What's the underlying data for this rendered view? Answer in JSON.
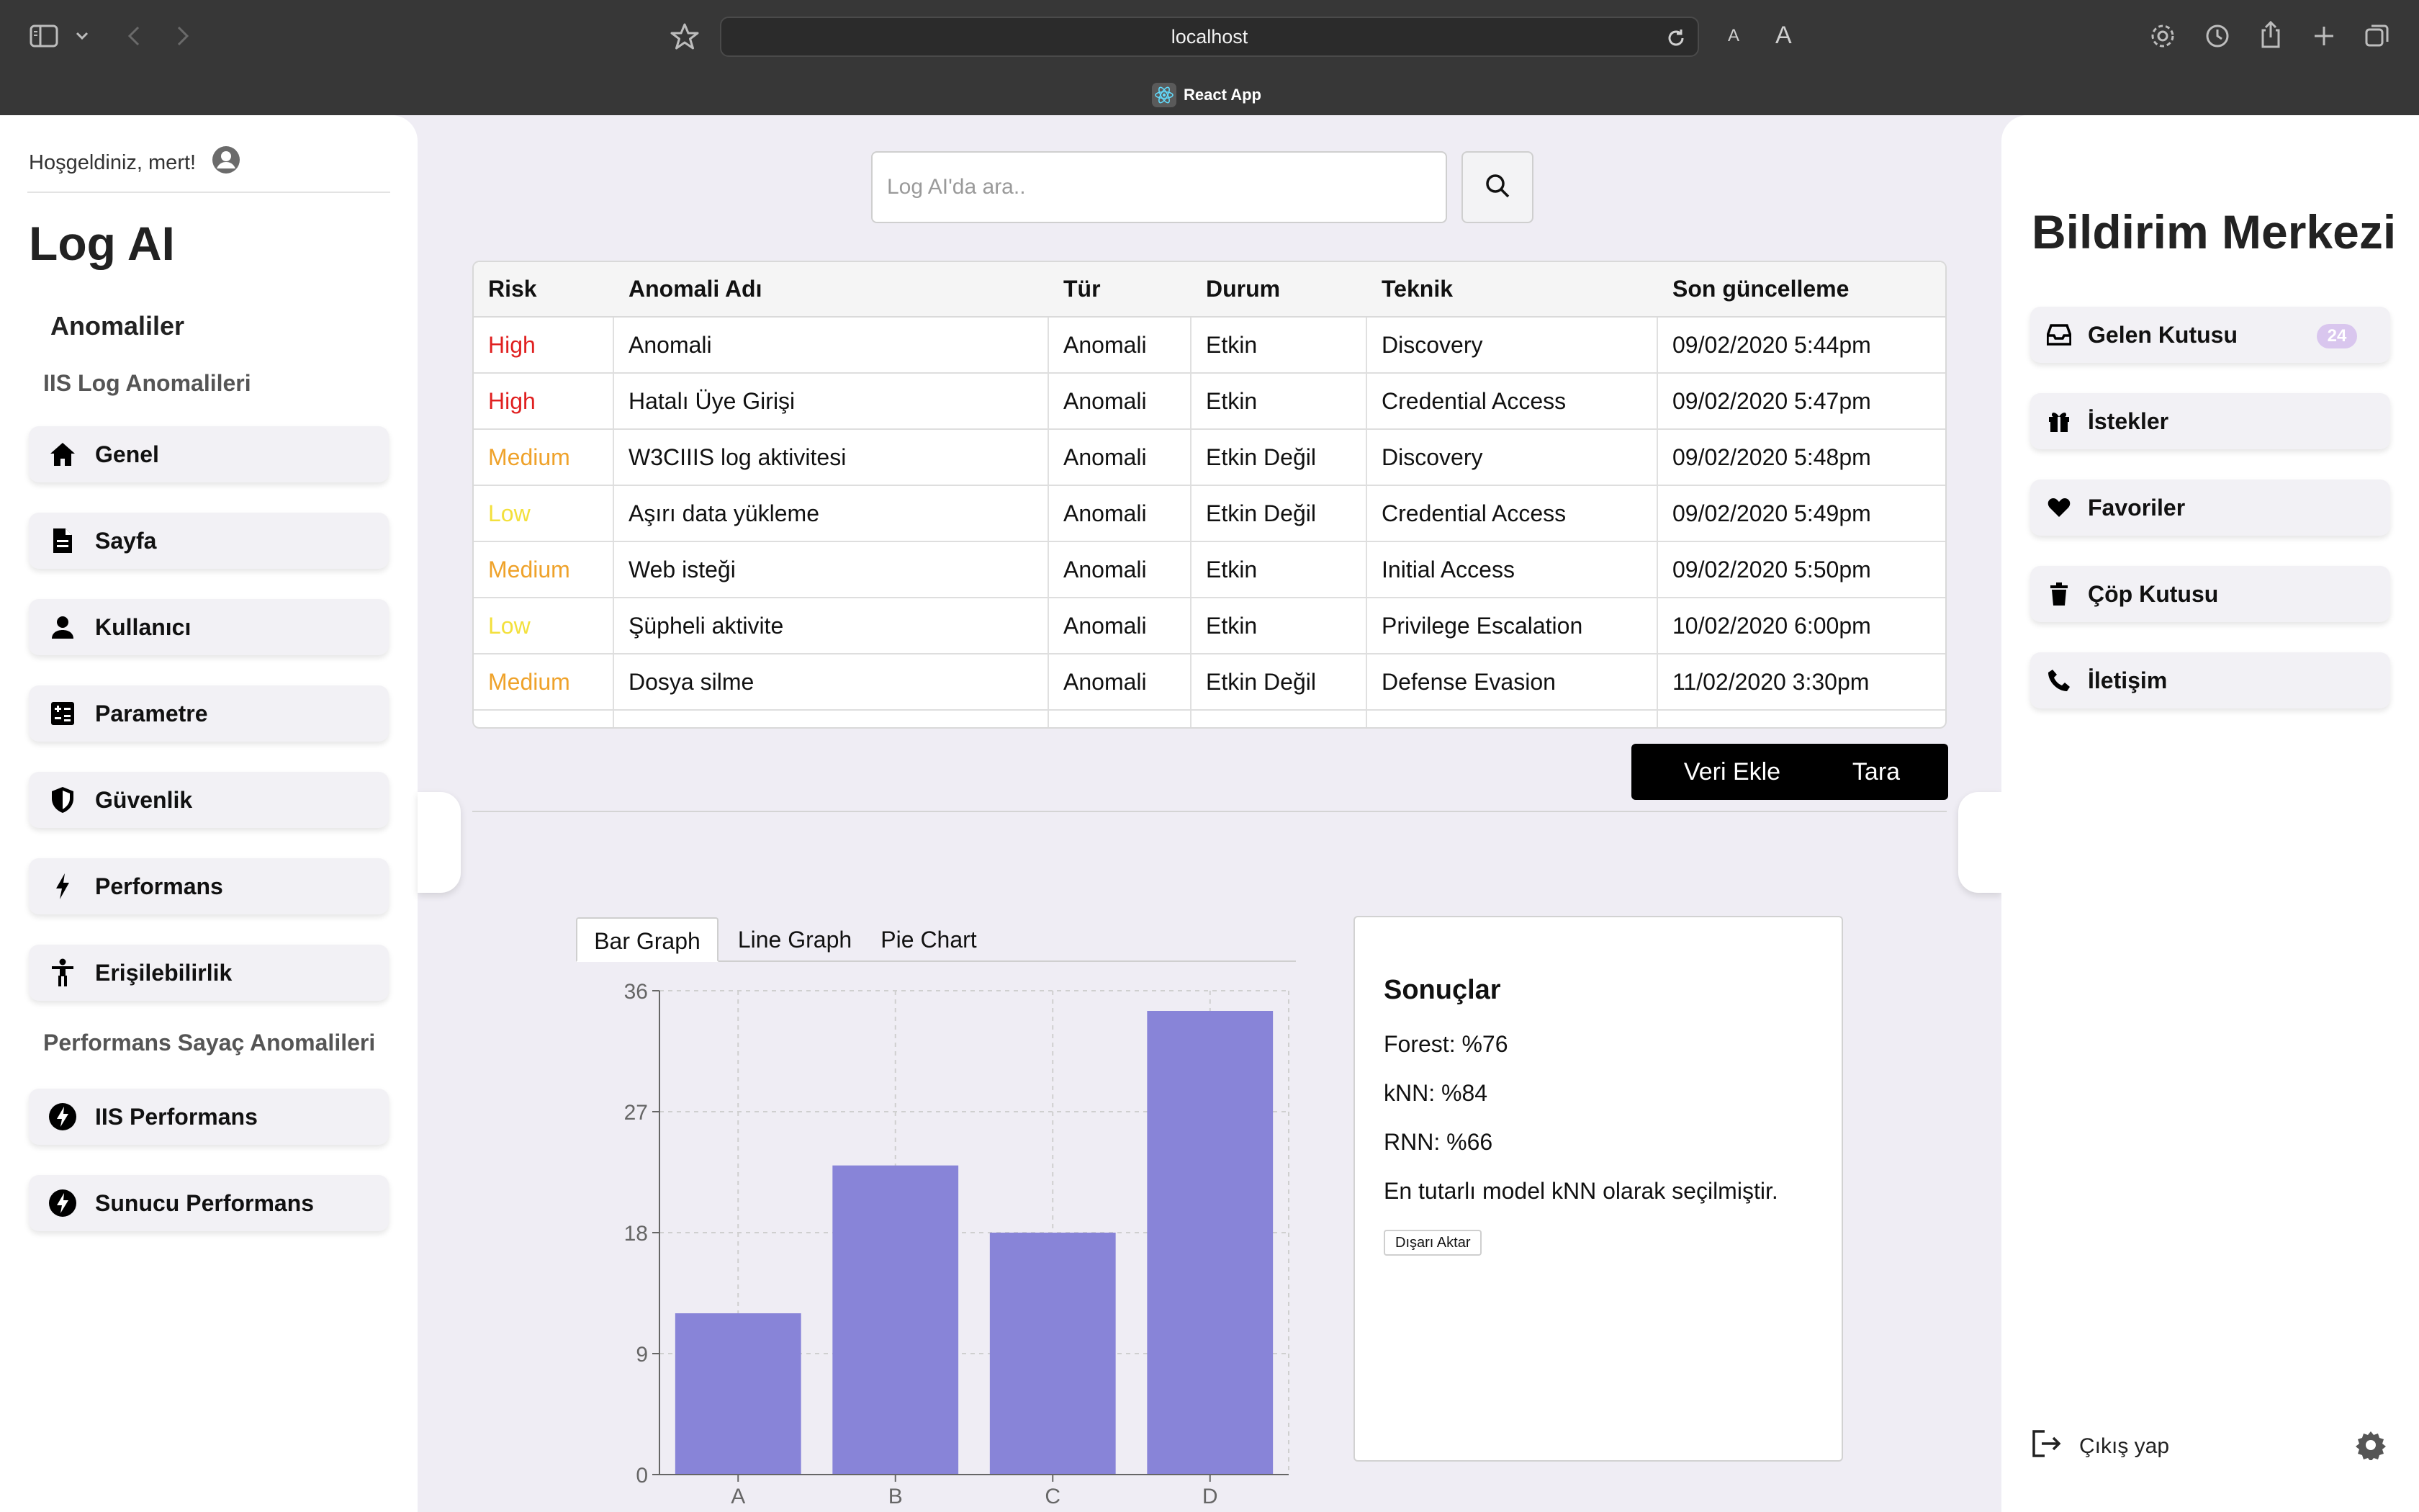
{
  "browser": {
    "url": "localhost",
    "tab_title": "React App",
    "font_small": "A",
    "font_large": "A"
  },
  "sidebar": {
    "welcome": "Hoşgeldiniz, mert!",
    "app_title": "Log AI",
    "section_title": "Anomaliler",
    "group1_title": "IIS Log Anomalileri",
    "group2_title": "Performans Sayaç Anomalileri",
    "items": [
      {
        "label": "Genel",
        "icon": "home-icon"
      },
      {
        "label": "Sayfa",
        "icon": "document-icon"
      },
      {
        "label": "Kullanıcı",
        "icon": "person-icon"
      },
      {
        "label": "Parametre",
        "icon": "calculator-icon"
      },
      {
        "label": "Güvenlik",
        "icon": "shield-icon"
      },
      {
        "label": "Performans",
        "icon": "bolt-icon"
      },
      {
        "label": "Erişilebilirlik",
        "icon": "accessibility-icon"
      }
    ],
    "items2": [
      {
        "label": "IIS Performans",
        "icon": "bolt-circle-icon"
      },
      {
        "label": "Sunucu Performans",
        "icon": "bolt-circle-icon"
      }
    ]
  },
  "search": {
    "placeholder": "Log AI'da ara.."
  },
  "table": {
    "headers": [
      "Risk",
      "Anomali Adı",
      "Tür",
      "Durum",
      "Teknik",
      "Son güncelleme"
    ],
    "rows": [
      {
        "risk": "High",
        "level": "high",
        "name": "Anomali",
        "type": "Anomali",
        "status": "Etkin",
        "technique": "Discovery",
        "updated": "09/02/2020 5:44pm"
      },
      {
        "risk": "High",
        "level": "high",
        "name": "Hatalı Üye Girişi",
        "type": "Anomali",
        "status": "Etkin",
        "technique": "Credential Access",
        "updated": "09/02/2020 5:47pm"
      },
      {
        "risk": "Medium",
        "level": "medium",
        "name": "W3CIIIS log aktivitesi",
        "type": "Anomali",
        "status": "Etkin Değil",
        "technique": "Discovery",
        "updated": "09/02/2020 5:48pm"
      },
      {
        "risk": "Low",
        "level": "low",
        "name": "Aşırı data yükleme",
        "type": "Anomali",
        "status": "Etkin Değil",
        "technique": "Credential Access",
        "updated": "09/02/2020 5:49pm"
      },
      {
        "risk": "Medium",
        "level": "medium",
        "name": "Web isteği",
        "type": "Anomali",
        "status": "Etkin",
        "technique": "Initial Access",
        "updated": "09/02/2020 5:50pm"
      },
      {
        "risk": "Low",
        "level": "low",
        "name": "Şüpheli aktivite",
        "type": "Anomali",
        "status": "Etkin",
        "technique": "Privilege Escalation",
        "updated": "10/02/2020 6:00pm"
      },
      {
        "risk": "Medium",
        "level": "medium",
        "name": "Dosya silme",
        "type": "Anomali",
        "status": "Etkin Değil",
        "technique": "Defense Evasion",
        "updated": "11/02/2020 3:30pm"
      },
      {
        "risk": "",
        "level": "",
        "name": "",
        "type": "",
        "status": "",
        "technique": "",
        "updated": ""
      }
    ]
  },
  "actions": {
    "add_data": "Veri Ekle",
    "scan": "Tara"
  },
  "chart_tabs": [
    "Bar Graph",
    "Line Graph",
    "Pie Chart"
  ],
  "chart_data": {
    "type": "bar",
    "categories": [
      "A",
      "B",
      "C",
      "D"
    ],
    "values": [
      12,
      23,
      18,
      34.5
    ],
    "yticks": [
      0,
      9,
      18,
      27,
      36
    ],
    "ylim": [
      0,
      36
    ],
    "grid": true,
    "bar_color": "#8884d8"
  },
  "results": {
    "title": "Sonuçlar",
    "lines": [
      "Forest: %76",
      "kNN: %84",
      "RNN: %66",
      "En tutarlı model kNN olarak seçilmiştir."
    ],
    "export": "Dışarı Aktar"
  },
  "notifications": {
    "title": "Bildirim Merkezi",
    "items": [
      {
        "label": "Gelen Kutusu",
        "icon": "inbox-icon"
      },
      {
        "label": "İstekler",
        "icon": "gift-icon"
      },
      {
        "label": "Favoriler",
        "icon": "heart-icon"
      },
      {
        "label": "Çöp Kutusu",
        "icon": "trash-icon"
      },
      {
        "label": "İletişim",
        "icon": "phone-icon"
      }
    ],
    "inbox_count": "24",
    "logout": "Çıkış yap"
  },
  "colors": {
    "risk_high": "#e02020",
    "risk_medium": "#efa22a",
    "risk_low": "#f3e03c",
    "bar": "#8884d8",
    "badge": "#d9c6ee"
  }
}
